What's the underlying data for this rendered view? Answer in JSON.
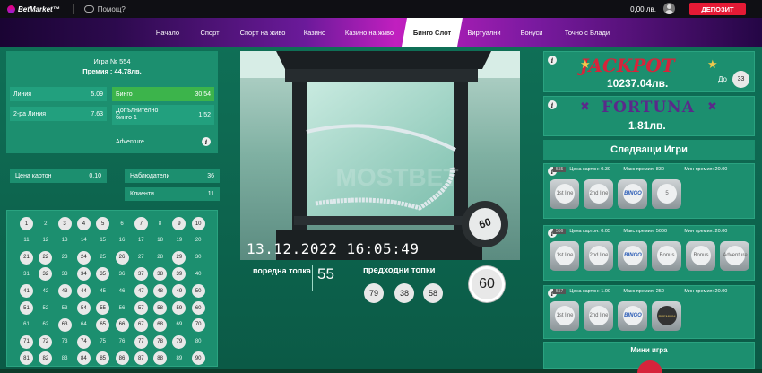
{
  "top": {
    "logo": "BetMarket™",
    "help": "Помощ?",
    "balance": "0,00 лв.",
    "deposit": "ДЕПОЗИТ"
  },
  "nav": [
    "Начало",
    "Спорт",
    "Спорт на живо",
    "Казино",
    "Казино на живо",
    "Бинго Слот",
    "Виртуални",
    "Бонуси",
    "Точно с Влади"
  ],
  "left": {
    "game_no": "Игра № 554",
    "prize": "Премия : 44.78лв.",
    "line_label": "Линия",
    "line_val": "5.09",
    "line2_label": "2-ра Линия",
    "line2_val": "7.63",
    "bingo_label": "Бинго",
    "bingo_val": "30.54",
    "extra_label": "Допълнително бинго 1",
    "extra_val": "1.52",
    "adventure": "Adventure",
    "card_price_label": "Цена картон",
    "card_price_val": "0.10",
    "watchers_label": "Наблюдатели",
    "watchers_val": "36",
    "clients_label": "Клиенти",
    "clients_val": "11"
  },
  "balls": {
    "numbers": [
      1,
      2,
      3,
      4,
      5,
      6,
      7,
      8,
      9,
      10,
      11,
      12,
      13,
      14,
      15,
      16,
      17,
      18,
      19,
      20,
      21,
      22,
      23,
      24,
      25,
      26,
      27,
      28,
      29,
      30,
      31,
      32,
      33,
      34,
      35,
      36,
      37,
      38,
      39,
      40,
      41,
      42,
      43,
      44,
      45,
      46,
      47,
      48,
      49,
      50,
      51,
      52,
      53,
      54,
      55,
      56,
      57,
      58,
      59,
      60,
      61,
      62,
      63,
      64,
      65,
      66,
      67,
      68,
      69,
      70,
      71,
      72,
      73,
      74,
      75,
      76,
      77,
      78,
      79,
      80,
      81,
      82,
      83,
      84,
      85,
      86,
      87,
      88,
      89,
      90
    ],
    "drawn": [
      1,
      3,
      4,
      5,
      7,
      9,
      10,
      21,
      22,
      24,
      26,
      29,
      32,
      34,
      35,
      37,
      38,
      39,
      41,
      43,
      44,
      47,
      48,
      49,
      50,
      51,
      54,
      55,
      57,
      58,
      59,
      60,
      63,
      65,
      66,
      67,
      68,
      70,
      71,
      72,
      74,
      77,
      78,
      79,
      81,
      82,
      84,
      85,
      86,
      87,
      88,
      90
    ]
  },
  "video": {
    "timestamp": "13.12.2022 16:05:49",
    "current_ball": "60",
    "watermark": "MOSTBET"
  },
  "draw": {
    "order_label": "поредна топка",
    "order_num": "55",
    "prev_label": "предходни топки",
    "prev": [
      "79",
      "38",
      "58"
    ],
    "big": "60"
  },
  "right": {
    "jackpot_title": "JACKPOT",
    "jackpot_amount": "10237.04лв.",
    "jackpot_to": "До",
    "jackpot_num": "33",
    "fortuna_title": "FORTUNA",
    "fortuna_amount": "1.81лв.",
    "next_games": "Следващи Игри",
    "mini_game": "Мини игра"
  },
  "games": [
    {
      "id": "555",
      "price": "Цена картон: 0.30",
      "max": "Макс премия: 830",
      "min": "Мин премия: 20.00",
      "tiles": [
        "1st line",
        "2nd line",
        "BINGO",
        "5"
      ]
    },
    {
      "id": "556",
      "price": "Цена картон: 0.05",
      "max": "Макс премия: 5000",
      "min": "Мин премия: 20.00",
      "tiles": [
        "1st line",
        "2nd line",
        "BINGO",
        "Bonus",
        "Bonus",
        "Adventure"
      ]
    },
    {
      "id": "557",
      "price": "Цена картон: 1.00",
      "max": "Макс премия: 250",
      "min": "Мин премия: 20.00",
      "tiles": [
        "1st line",
        "2nd line",
        "BINGO",
        "PREMIUM"
      ]
    }
  ]
}
